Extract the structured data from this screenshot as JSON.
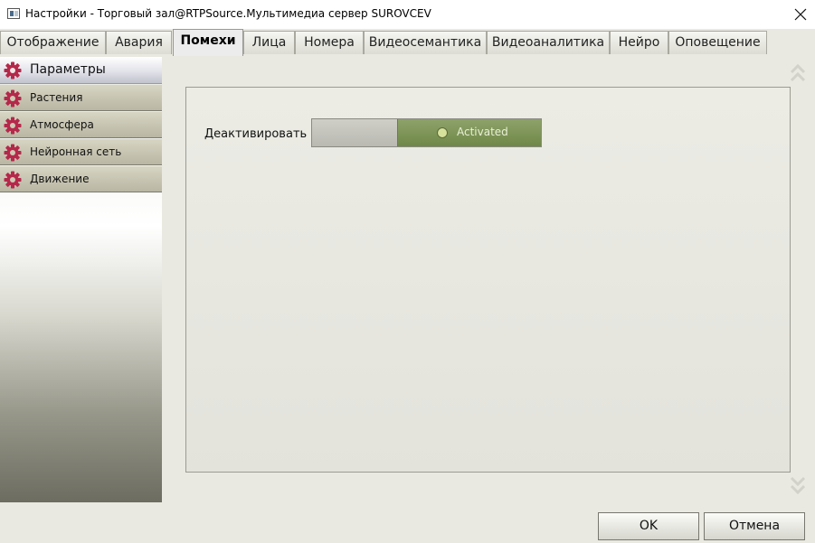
{
  "window": {
    "title": "Настройки - Торговый зал@RTPSource.Мультимедиа сервер SUROVCEV"
  },
  "tabs": [
    {
      "label": "Отображение",
      "active": false
    },
    {
      "label": "Авария",
      "active": false
    },
    {
      "label": "Помехи",
      "active": true
    },
    {
      "label": "Лица",
      "active": false
    },
    {
      "label": "Номера",
      "active": false
    },
    {
      "label": "Видеосемантика",
      "active": false
    },
    {
      "label": "Видеоаналитика",
      "active": false
    },
    {
      "label": "Нейро",
      "active": false
    },
    {
      "label": "Оповещение",
      "active": false
    }
  ],
  "sidebar": {
    "header": {
      "label": "Параметры",
      "icon": "gear-icon"
    },
    "items": [
      {
        "label": "Растения",
        "icon": "gear-icon"
      },
      {
        "label": "Атмосфера",
        "icon": "gear-icon"
      },
      {
        "label": "Нейронная сеть",
        "icon": "gear-icon"
      },
      {
        "label": "Движение",
        "icon": "gear-icon"
      }
    ]
  },
  "content": {
    "deactivate_label": "Деактивировать",
    "toggle_state_label": "Activated"
  },
  "buttons": {
    "ok": "OK",
    "cancel": "Отмена"
  },
  "colors": {
    "gear_icon": "#b5284a",
    "toggle_on": "#7a9455",
    "window_bg": "#e9e9e1"
  }
}
